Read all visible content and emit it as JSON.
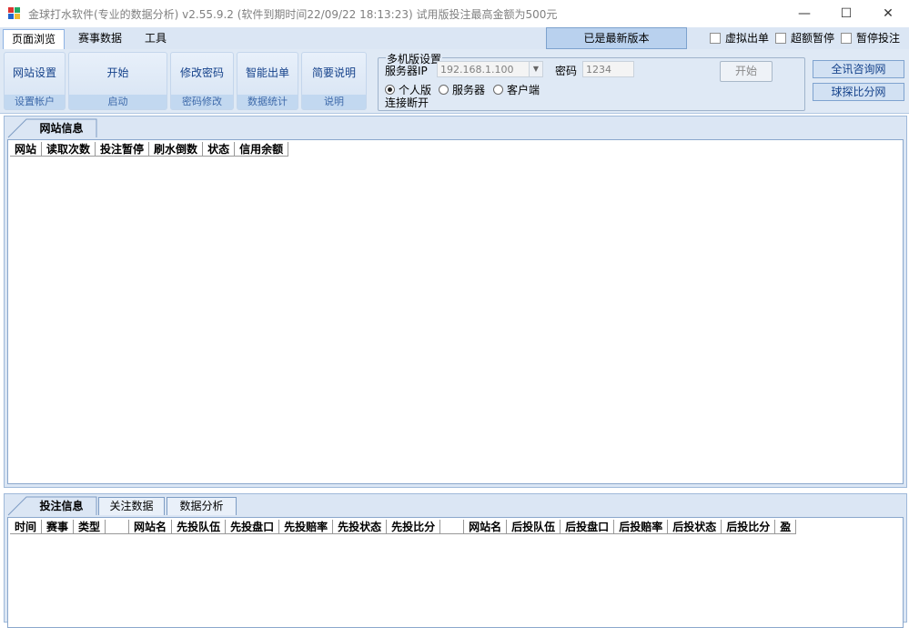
{
  "window": {
    "title": "金球打水软件(专业的数据分析) v2.55.9.2 (软件到期时间22/09/22 18:13:23) 试用版投注最高金额为500元",
    "minimize": "—",
    "maximize": "☐",
    "close": "✕"
  },
  "menu": {
    "tabs": [
      {
        "label": "页面浏览"
      },
      {
        "label": "赛事数据"
      },
      {
        "label": "工具"
      }
    ],
    "latest_button": "已是最新版本",
    "checkboxes": [
      {
        "label": "虚拟出单",
        "checked": false
      },
      {
        "label": "超额暂停",
        "checked": false
      },
      {
        "label": "暂停投注",
        "checked": false
      }
    ]
  },
  "ribbon": {
    "groups": [
      {
        "button": "网站设置",
        "caption": "设置帐户"
      },
      {
        "button": "开始",
        "caption": "启动"
      },
      {
        "button": "修改密码",
        "caption": "密码修改"
      },
      {
        "button": "智能出单",
        "caption": "数据统计"
      },
      {
        "button": "简要说明",
        "caption": "说明"
      }
    ],
    "multi": {
      "legend": "多机版设置",
      "server_ip_label": "服务器IP",
      "server_ip_value": "192.168.1.100",
      "password_label": "密码",
      "password_value": "1234",
      "start_button": "开始",
      "modes": [
        {
          "label": "个人版",
          "selected": true
        },
        {
          "label": "服务器",
          "selected": false
        },
        {
          "label": "客户端",
          "selected": false
        }
      ],
      "status": "连接断开"
    },
    "side_buttons": [
      "全讯咨询网",
      "球探比分网"
    ]
  },
  "top_panel": {
    "tab": "网站信息",
    "columns": [
      "网站",
      "读取次数",
      "投注暂停",
      "刷水倒数",
      "状态",
      "信用余额"
    ]
  },
  "bottom_panel": {
    "tabs": [
      "投注信息",
      "关注数据",
      "数据分析"
    ],
    "columns": [
      "时间",
      "赛事",
      "类型",
      "",
      "网站名",
      "先投队伍",
      "先投盘口",
      "先投赔率",
      "先投状态",
      "先投比分",
      "",
      "网站名",
      "后投队伍",
      "后投盘口",
      "后投赔率",
      "后投状态",
      "后投比分",
      "盈"
    ]
  }
}
